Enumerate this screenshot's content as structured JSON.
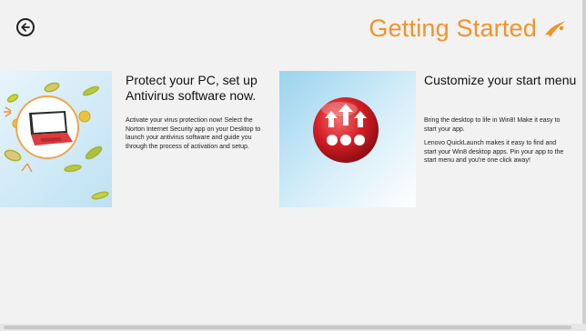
{
  "header": {
    "title": "Getting Started",
    "accent_color": "#f0932b",
    "back_icon": "back-arrow-icon",
    "brand_icon": "lenovo-swoosh-icon"
  },
  "cards": [
    {
      "heading": "Protect your PC, set up Antivirus software now.",
      "image_icon": "laptop-with-viruses-icon",
      "paragraphs": [
        "Activate your virus protection now!  Select the Norton Internet Security app on your Desktop to launch your antivirus software and guide you through the process of activation and setup."
      ]
    },
    {
      "heading": "Customize your start menu",
      "image_icon": "quicklaunch-arrows-icon",
      "paragraphs": [
        "Bring the desktop to life in Win8! Make it easy to start your app.",
        "Lenovo QuickLaunch makes it easy to find and start your Win8 desktop apps. Pin your app to the start menu and you're one click away!"
      ]
    }
  ]
}
